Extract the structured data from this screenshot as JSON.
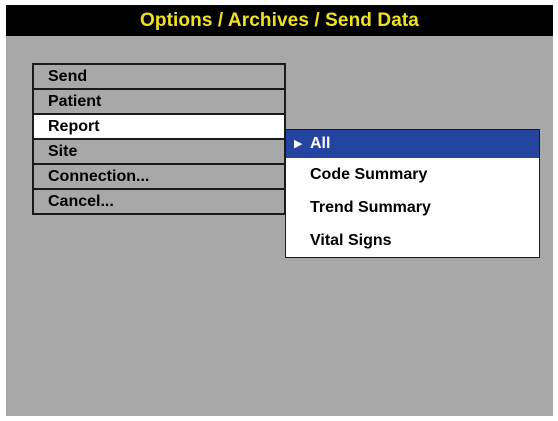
{
  "window": {
    "title": "Options / Archives / Send Data"
  },
  "menu": {
    "items": [
      {
        "label": "Send"
      },
      {
        "label": "Patient"
      },
      {
        "label": "Report"
      },
      {
        "label": "Site"
      },
      {
        "label": "Connection..."
      },
      {
        "label": "Cancel..."
      }
    ],
    "selected_index": 2
  },
  "submenu": {
    "items": [
      {
        "label": "All"
      },
      {
        "label": "Code Summary"
      },
      {
        "label": "Trend Summary"
      },
      {
        "label": "Vital Signs"
      }
    ],
    "highlighted_index": 0
  },
  "colors": {
    "title_bg": "#000000",
    "title_text": "#f0e020",
    "screen_bg": "#a8a8a8",
    "highlight": "#24459f"
  },
  "icons": {
    "submenu_pointer": "triangle-right-icon"
  }
}
